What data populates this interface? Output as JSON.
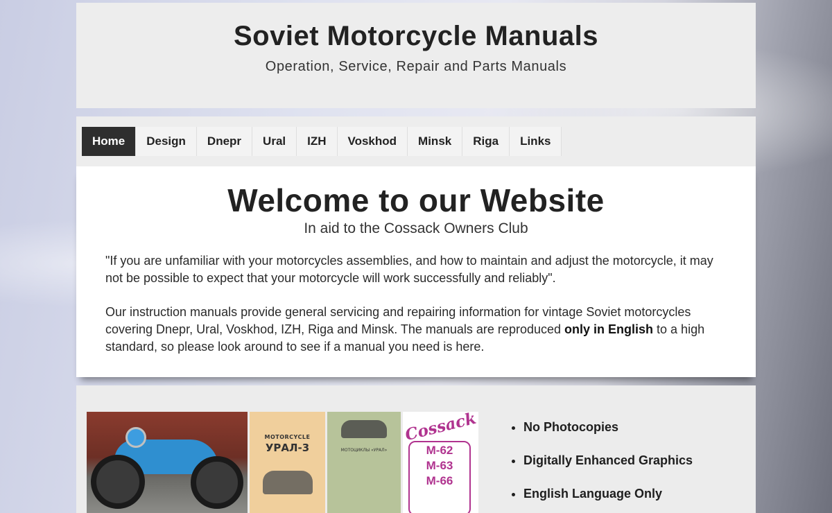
{
  "header": {
    "title": "Soviet Motorcycle Manuals",
    "subtitle": "Operation, Service, Repair and Parts Manuals"
  },
  "nav": {
    "items": [
      {
        "label": "Home",
        "active": true
      },
      {
        "label": "Design",
        "active": false
      },
      {
        "label": "Dnepr",
        "active": false
      },
      {
        "label": "Ural",
        "active": false
      },
      {
        "label": "IZH",
        "active": false
      },
      {
        "label": "Voskhod",
        "active": false
      },
      {
        "label": "Minsk",
        "active": false
      },
      {
        "label": "Riga",
        "active": false
      },
      {
        "label": "Links",
        "active": false
      }
    ]
  },
  "welcome": {
    "title": "Welcome to our Website",
    "subtitle": "In aid to the Cossack Owners Club",
    "quote": "\"If you are unfamiliar with your motorcycles assemblies, and how to maintain and adjust the motorcycle, it may not be possible to expect that your motorcycle will work successfully and reliably\".",
    "intro_before": "Our instruction manuals provide general servicing and repairing information for vintage Soviet motorcycles covering Dnepr, Ural, Voskhod, IZH, Riga and Minsk. The manuals are reproduced ",
    "intro_bold": "only in English",
    "intro_after": " to a high standard, so please look around to see if a manual you need is here."
  },
  "gallery": {
    "book1": {
      "top": "MOTORCYCLE",
      "title": "УРАЛ-3"
    },
    "book2": {
      "text": "МОТОЦИКЛЫ «УРАЛ»"
    },
    "book3": {
      "brand": "Cossack",
      "models": [
        "M-62",
        "M-63",
        "M-66"
      ]
    }
  },
  "features": [
    "No Photocopies",
    "Digitally Enhanced Graphics",
    "English Language Only"
  ],
  "colors": {
    "nav_active_bg": "#2e2e2e",
    "panel_bg": "#ededed",
    "cossack_magenta": "#b0338f"
  }
}
